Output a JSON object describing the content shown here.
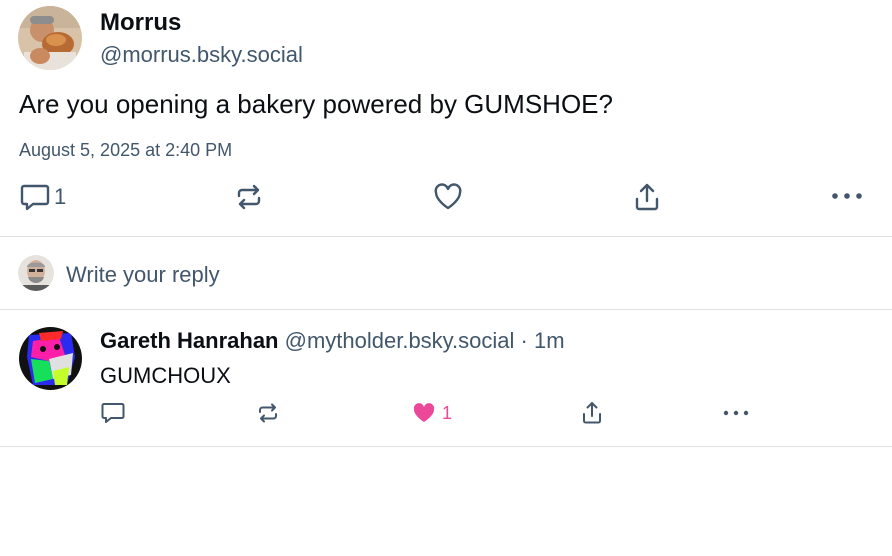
{
  "post": {
    "author_name": "Morrus",
    "author_handle": "@morrus.bsky.social",
    "text": "Are you opening a bakery powered by GUMSHOE?",
    "date": "August 5, 2025 at 2:40 PM",
    "reply_count": "1"
  },
  "reply_box": {
    "placeholder": "Write your reply"
  },
  "reply": {
    "author_name": "Gareth Hanrahan",
    "author_handle": "@mytholder.bsky.social",
    "separator": "·",
    "time": "1m",
    "text": "GUMCHOUX",
    "like_count": "1"
  },
  "colors": {
    "text_primary": "#0b0f14",
    "text_secondary": "#42576c",
    "divider": "#dfe3e8",
    "like": "#ec4899"
  },
  "icons": [
    "comment-icon",
    "repost-icon",
    "heart-icon",
    "share-icon",
    "more-icon"
  ]
}
